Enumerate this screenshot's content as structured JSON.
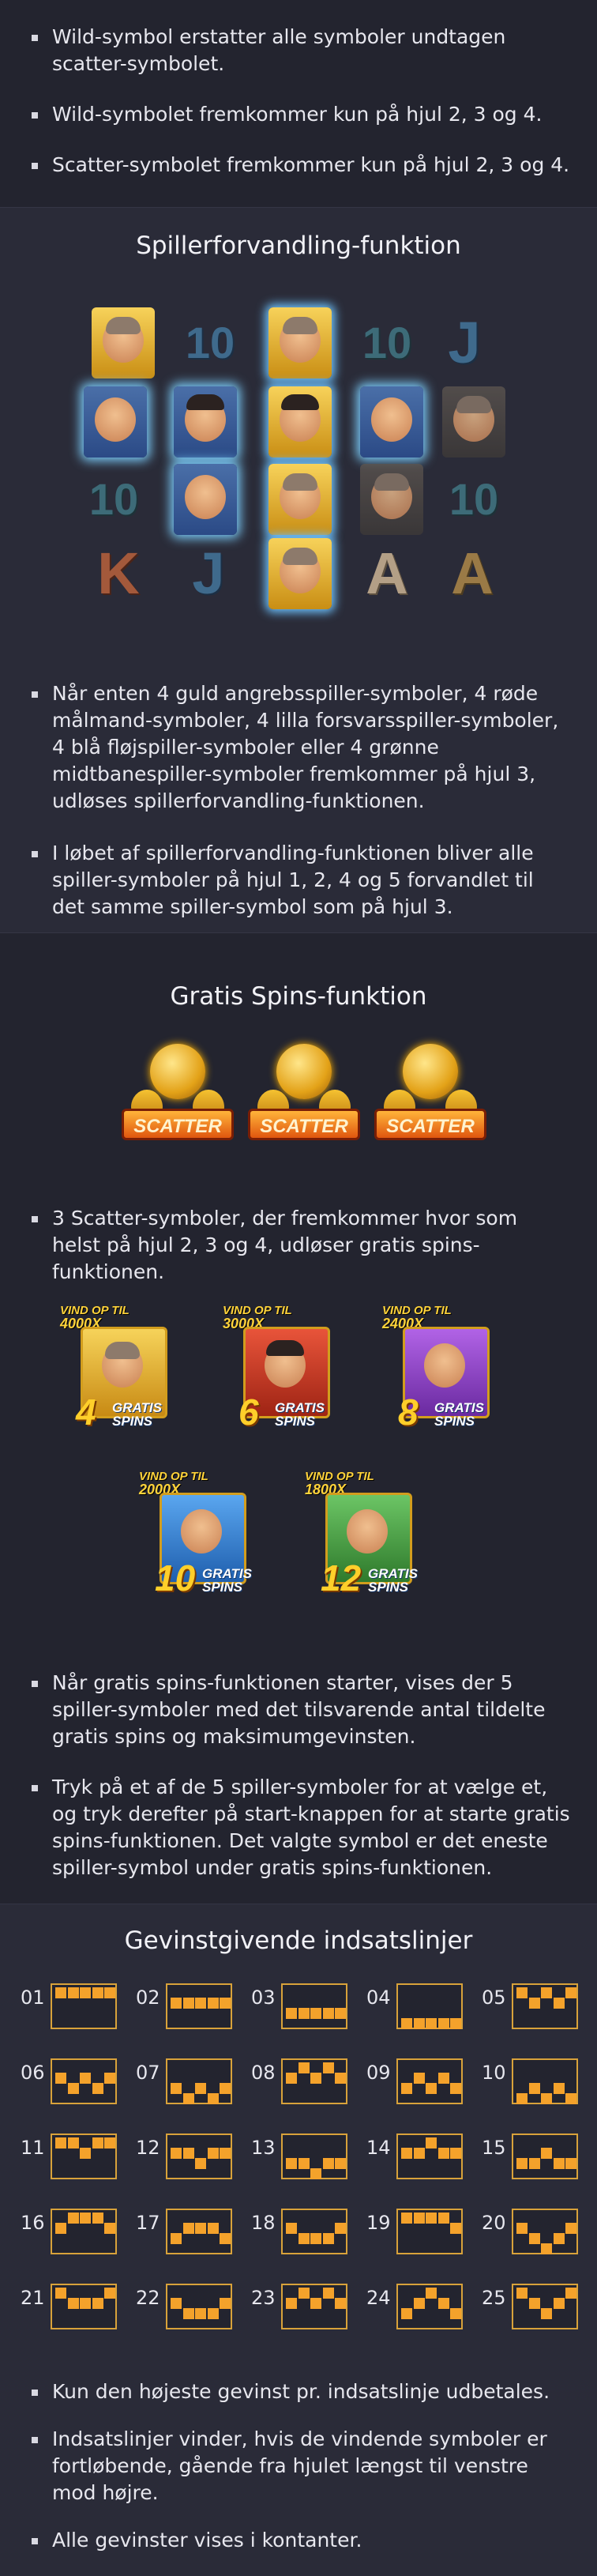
{
  "wild_bullets": [
    "Wild-symbol erstatter alle symboler undtagen scatter-symbolet.",
    "Wild-symbolet fremkommer kun på hjul 2, 3 og 4.",
    "Scatter-symbolet fremkommer kun på hjul 2, 3 og 4."
  ],
  "transform": {
    "title": "Spillerforvandling-funktion",
    "reel_letters": [
      "10",
      "10",
      "J",
      "10",
      "10",
      "K",
      "J",
      "A",
      "A"
    ],
    "bullets": [
      "Når enten 4 guld angrebsspiller-symboler, 4 røde målmand-symboler, 4 lilla forsvarsspiller-symboler, 4 blå fløjspiller-symboler eller 4 grønne midtbanespiller-symboler fremkommer på hjul 3, udløses spillerforvandling-funktionen.",
      "I løbet af spillerforvandling-funktionen bliver alle spiller-symboler på hjul 1, 2, 4 og 5 forvandlet til det samme spiller-symbol som på hjul 3."
    ]
  },
  "free_spins": {
    "title": "Gratis Spins-funktion",
    "scatter_label": "SCATTER",
    "scatter_bullets": [
      "3 Scatter-symboler, der fremkommer hvor som helst på hjul 2, 3 og 4, udløser gratis spins-funktionen."
    ],
    "cards": [
      {
        "prefix": "VIND OP TIL",
        "multiplier": "4000X",
        "spins": "4",
        "gratis": "GRATIS",
        "spins_word": "SPINS",
        "color": "#f2c230"
      },
      {
        "prefix": "VIND OP TIL",
        "multiplier": "3000X",
        "spins": "6",
        "gratis": "GRATIS",
        "spins_word": "SPINS",
        "color": "#d8462c"
      },
      {
        "prefix": "VIND OP TIL",
        "multiplier": "2400X",
        "spins": "8",
        "gratis": "GRATIS",
        "spins_word": "SPINS",
        "color": "#9b4bd6"
      },
      {
        "prefix": "VIND OP TIL",
        "multiplier": "2000X",
        "spins": "10",
        "gratis": "GRATIS",
        "spins_word": "SPINS",
        "color": "#3c8ee3"
      },
      {
        "prefix": "VIND OP TIL",
        "multiplier": "1800X",
        "spins": "12",
        "gratis": "GRATIS",
        "spins_word": "SPINS",
        "color": "#4fae4a"
      }
    ],
    "bullets": [
      "Når gratis spins-funktionen starter, vises der 5 spiller-symboler med det tilsvarende antal tildelte gratis spins og maksimumgevinsten.",
      "Tryk på et af de 5 spiller-symboler for at vælge et, og tryk derefter på start-knappen for at starte gratis spins-funktionen. Det valgte symbol er det eneste spiller-symbol under gratis spins-funktionen."
    ]
  },
  "paylines": {
    "title": "Gevinstgivende indsatslinjer",
    "lines": [
      {
        "n": "01",
        "rows": [
          0,
          0,
          0,
          0,
          0
        ]
      },
      {
        "n": "02",
        "rows": [
          1,
          1,
          1,
          1,
          1
        ]
      },
      {
        "n": "03",
        "rows": [
          2,
          2,
          2,
          2,
          2
        ]
      },
      {
        "n": "04",
        "rows": [
          3,
          3,
          3,
          3,
          3
        ]
      },
      {
        "n": "05",
        "rows": [
          0,
          1,
          0,
          1,
          0
        ]
      },
      {
        "n": "06",
        "rows": [
          1,
          2,
          1,
          2,
          1
        ]
      },
      {
        "n": "07",
        "rows": [
          2,
          3,
          2,
          3,
          2
        ]
      },
      {
        "n": "08",
        "rows": [
          1,
          0,
          1,
          0,
          1
        ]
      },
      {
        "n": "09",
        "rows": [
          2,
          1,
          2,
          1,
          2
        ]
      },
      {
        "n": "10",
        "rows": [
          3,
          2,
          3,
          2,
          3
        ]
      },
      {
        "n": "11",
        "rows": [
          0,
          0,
          1,
          0,
          0
        ]
      },
      {
        "n": "12",
        "rows": [
          1,
          1,
          2,
          1,
          1
        ]
      },
      {
        "n": "13",
        "rows": [
          2,
          2,
          3,
          2,
          2
        ]
      },
      {
        "n": "14",
        "rows": [
          1,
          1,
          0,
          1,
          1
        ]
      },
      {
        "n": "15",
        "rows": [
          2,
          2,
          1,
          2,
          2
        ]
      },
      {
        "n": "16",
        "rows": [
          1,
          0,
          0,
          0,
          1
        ]
      },
      {
        "n": "17",
        "rows": [
          2,
          1,
          1,
          1,
          2
        ]
      },
      {
        "n": "18",
        "rows": [
          1,
          2,
          2,
          2,
          1
        ]
      },
      {
        "n": "19",
        "rows": [
          0,
          0,
          0,
          0,
          1
        ]
      },
      {
        "n": "20",
        "rows": [
          1,
          2,
          3,
          2,
          1
        ]
      },
      {
        "n": "21",
        "rows": [
          0,
          1,
          1,
          1,
          0
        ]
      },
      {
        "n": "22",
        "rows": [
          1,
          2,
          2,
          2,
          1
        ]
      },
      {
        "n": "23",
        "rows": [
          1,
          0,
          1,
          0,
          1
        ]
      },
      {
        "n": "24",
        "rows": [
          2,
          1,
          0,
          1,
          2
        ]
      },
      {
        "n": "25",
        "rows": [
          0,
          1,
          2,
          1,
          0
        ]
      }
    ],
    "bullets": [
      "Kun den højeste gevinst pr. indsatslinje udbetales.",
      "Indsatslinjer vinder, hvis de vindende symboler er fortløbende, gående fra hjulet længst til venstre mod højre.",
      "Alle gevinster vises i kontanter."
    ]
  }
}
